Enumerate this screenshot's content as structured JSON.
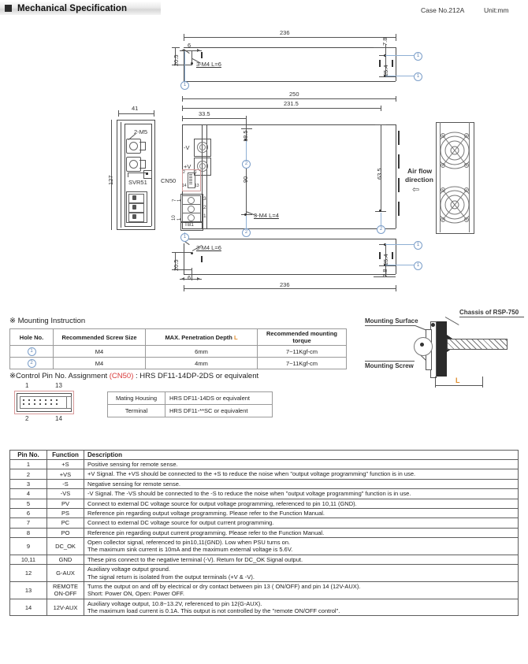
{
  "header": {
    "title": "Mechanical Specification",
    "case_no": "Case No.212A",
    "unit": "Unit:mm"
  },
  "drawing": {
    "top_view": {
      "dim_236": "236",
      "dim_6": "6",
      "dim_20_5": "20.5",
      "dim_7_8": "7.8",
      "dim_25_4": "25.4",
      "screw_note": "3-M4 L=6",
      "callout_1a": "1",
      "callout_1b": "1",
      "callout_1c": "1"
    },
    "side_view": {
      "dim_41": "41",
      "dim_127": "127",
      "label_2m5": "2-M5",
      "label_svr51": "SVR51"
    },
    "front_view": {
      "dim_250": "250",
      "dim_231_5": "231.5",
      "dim_33_5": "33.5",
      "dim_18_5": "18.5",
      "dim_90": "90",
      "dim_63_5": "63.5",
      "label_minus_v": "-V",
      "label_plus_v": "+V",
      "label_cn50": "CN50",
      "label_tb1": "TB1",
      "cn50_pin_1": "1",
      "cn50_pin_2": "2",
      "cn50_pin_13": "13",
      "cn50_pin_14": "14",
      "tb1_pin_3": "3",
      "tb1_pin_2": "2",
      "tb1_pin_1": "1",
      "tb1_left_top": "7",
      "tb1_left_top2": "1",
      "tb1_left_bot": "10",
      "tb1_left_bot2": "1",
      "screw_note": "3-M4 L=4",
      "callout_2a": "2",
      "callout_2b": "2",
      "callout_2c": "2"
    },
    "fan_view": {
      "airflow_line1": "Air flow",
      "airflow_line2": "direction",
      "airflow_arrow": "⇦"
    },
    "bottom_view": {
      "dim_236": "236",
      "dim_6": "6",
      "dim_20_5": "20.5",
      "dim_7_8": "7.8",
      "dim_25_4": "25.4",
      "screw_note": "3-M4 L=6",
      "callout_1a": "1",
      "callout_1b": "1",
      "callout_1c": "1"
    }
  },
  "mounting_instruction": {
    "title": "※ Mounting Instruction",
    "headers": [
      "Hole No.",
      "Recommended Screw Size",
      "MAX. Penetration Depth ",
      "Recommended mounting torque"
    ],
    "header_depth_suffix": "L",
    "rows": [
      {
        "hole": "1",
        "screw": "M4",
        "depth": "6mm",
        "torque": "7~11Kgf-cm"
      },
      {
        "hole": "2",
        "screw": "M4",
        "depth": "4mm",
        "torque": "7~11Kgf-cm"
      }
    ]
  },
  "mounting_diagram": {
    "label_surface": "Mounting Surface",
    "label_chassis": "Chassis of RSP-750",
    "label_screw": "Mounting Screw",
    "label_L": "L"
  },
  "control_pin": {
    "title_prefix": "※Control Pin No. Assignment ",
    "title_cn50": "(CN50)",
    "title_suffix": " : HRS DF11-14DP-2DS or equivalent",
    "connector": {
      "pin_1": "1",
      "pin_13": "13",
      "pin_2": "2",
      "pin_14": "14"
    },
    "table": [
      {
        "key": "Mating Housing",
        "value": "HRS DF11-14DS or equivalent"
      },
      {
        "key": "Terminal",
        "value": "HRS DF11-**SC or equivalent"
      }
    ]
  },
  "pin_table": {
    "headers": [
      "Pin No.",
      "Function",
      "Description"
    ],
    "rows": [
      {
        "pin": "1",
        "fn": "+S",
        "desc": "Positive sensing for remote sense."
      },
      {
        "pin": "2",
        "fn": "+VS",
        "desc": "+V Signal. The +VS should be connected to the +S to reduce the noise when \"output voltage programming\" function is in use."
      },
      {
        "pin": "3",
        "fn": "-S",
        "desc": "Negative sensing for remote sense."
      },
      {
        "pin": "4",
        "fn": "-VS",
        "desc": "-V Signal. The -VS should be connected to the -S to reduce the noise when \"output voltage programming\" function is in use."
      },
      {
        "pin": "5",
        "fn": "PV",
        "desc": "Connect to external DC voltage source for output voltage programming, referenced to pin 10,11 (GND)."
      },
      {
        "pin": "6",
        "fn": "PS",
        "desc": "Reference pin regarding output voltage programming. Please refer to the Function Manual."
      },
      {
        "pin": "7",
        "fn": "PC",
        "desc": "Connect to external DC voltage source for output current programming."
      },
      {
        "pin": "8",
        "fn": "PO",
        "desc": "Reference pin regarding output current programming. Please refer to the Function Manual."
      },
      {
        "pin": "9",
        "fn": "DC_OK",
        "desc": "Open collector signal, referenced to pin10,11(GND). Low when PSU turns on.\nThe maximum sink current is 10mA and the maximum external voltage is 5.6V."
      },
      {
        "pin": "10,11",
        "fn": "GND",
        "desc": "These pins connect to the negative terminal (-V). Return for DC_OK Signal output."
      },
      {
        "pin": "12",
        "fn": "G-AUX",
        "desc": "Auxiliary voltage output ground.\nThe signal return is isolated from the output terminals (+V & -V)."
      },
      {
        "pin": "13",
        "fn": "REMOTE\nON-OFF",
        "desc": "Turns the output on and off by electrical or dry contact between pin 13 ( ON/OFF) and pin 14 (12V-AUX).\nShort: Power ON, Open: Power OFF."
      },
      {
        "pin": "14",
        "fn": "12V-AUX",
        "desc": "Auxiliary voltage output, 10.8~13.2V, referenced to pin 12(G-AUX).\nThe maximum load current is 0.1A. This output is not controlled by the \"remote ON/OFF control\"."
      }
    ]
  }
}
